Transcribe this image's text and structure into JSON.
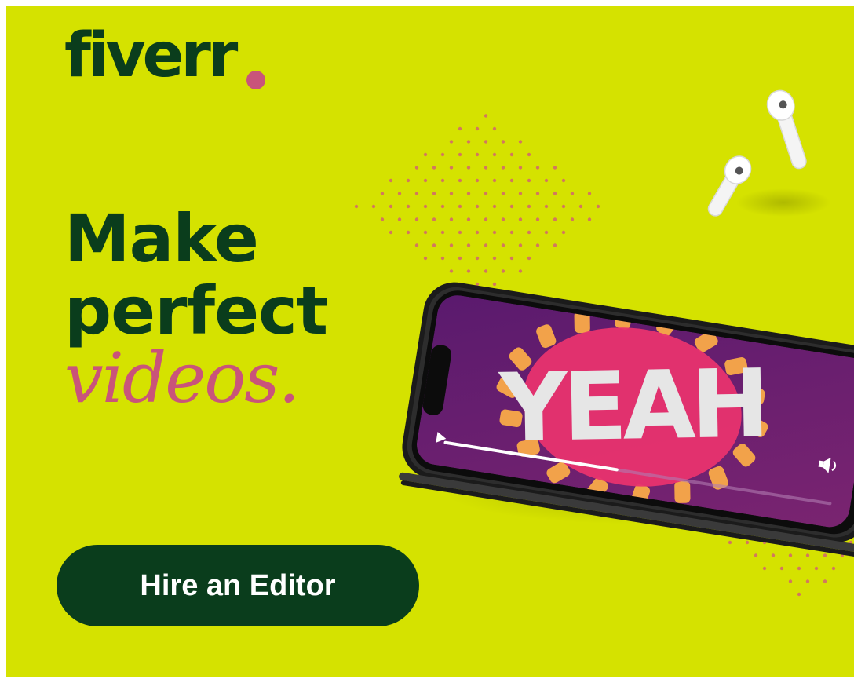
{
  "brand": {
    "logo_text": "fiverr",
    "dot_color": "#c9547a"
  },
  "headline": {
    "line1": "Make",
    "line2": "perfect",
    "line3": "videos."
  },
  "phone_screen": {
    "text": "YEAH",
    "progress": 0.45
  },
  "cta": {
    "label": "Hire an Editor"
  },
  "colors": {
    "background": "#d5e200",
    "primary": "#0a3d1c",
    "accent": "#c9547a",
    "screen": "#6a1f6a",
    "screen_highlight": "#e8336e",
    "burst": "#f2a24a"
  },
  "icons": {
    "earbuds": "earbuds-icon",
    "play": "play-icon",
    "volume": "volume-icon"
  }
}
